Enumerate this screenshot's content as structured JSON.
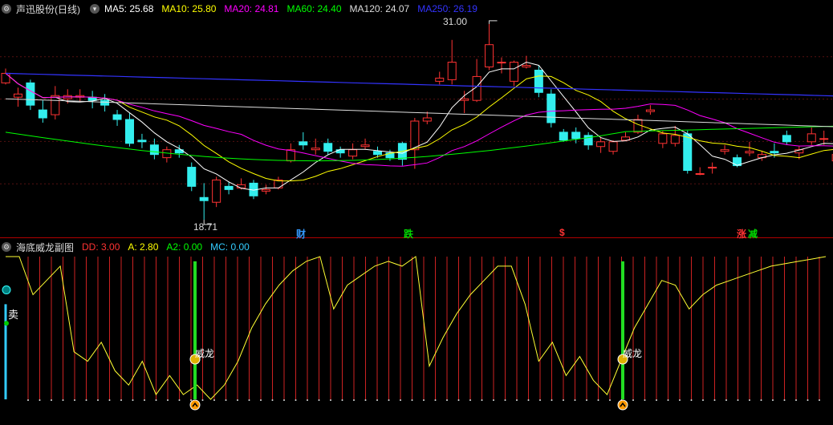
{
  "main": {
    "title": "声迅股份(日线)",
    "ma": [
      {
        "label": "MA5: 25.68",
        "color": "#ffffff"
      },
      {
        "label": "MA10: 25.80",
        "color": "#ffff00"
      },
      {
        "label": "MA20: 24.81",
        "color": "#ff00ff"
      },
      {
        "label": "MA60: 24.40",
        "color": "#00ff00"
      },
      {
        "label": "MA120: 24.07",
        "color": "#dddddd"
      },
      {
        "label": "MA250: 26.19",
        "color": "#3333ff"
      }
    ],
    "high_label": "31.00",
    "low_label": "18.71",
    "events": [
      {
        "text": "财",
        "color": "#3399ff"
      },
      {
        "text": "跌",
        "color": "#00dd00"
      },
      {
        "text": "$",
        "color": "#ff3333"
      },
      {
        "text": "涨",
        "color": "#ff3333"
      },
      {
        "text": "减",
        "color": "#00dd00"
      }
    ]
  },
  "sub": {
    "title": "海底威龙副图",
    "values": [
      {
        "label": "DD: 3.00",
        "color": "#ff3333"
      },
      {
        "label": "A: 2.80",
        "color": "#ffff00"
      },
      {
        "label": "A2: 0.00",
        "color": "#00ff00"
      },
      {
        "label": "MC: 0.00",
        "color": "#33ccff"
      }
    ],
    "sell_label": "卖",
    "signal_label": "威龙",
    "signal_label_2": "威龙"
  },
  "chart_data": {
    "type": "candlestick",
    "price_range": [
      18.71,
      31.0
    ],
    "candles": [
      [
        27.3,
        27.9,
        28.2,
        27.2
      ],
      [
        26.4,
        26.6,
        27.0,
        25.8
      ],
      [
        27.3,
        25.9,
        27.5,
        25.6
      ],
      [
        25.6,
        25.1,
        26.2,
        24.8
      ],
      [
        25.3,
        26.5,
        27.1,
        25.0
      ],
      [
        26.3,
        26.5,
        26.9,
        26.0
      ],
      [
        26.4,
        26.5,
        26.9,
        26.1
      ],
      [
        26.4,
        26.2,
        26.8,
        25.7
      ],
      [
        26.2,
        25.9,
        26.6,
        25.5
      ],
      [
        25.3,
        25.0,
        25.6,
        24.6
      ],
      [
        25.0,
        23.5,
        25.4,
        23.3
      ],
      [
        23.7,
        23.6,
        24.1,
        23.2
      ],
      [
        23.4,
        22.8,
        23.8,
        22.5
      ],
      [
        22.6,
        23.1,
        23.3,
        22.3
      ],
      [
        23.1,
        22.9,
        23.4,
        22.6
      ],
      [
        22.0,
        20.8,
        22.3,
        20.5
      ],
      [
        20.1,
        19.9,
        21.0,
        18.71
      ],
      [
        19.8,
        21.2,
        21.4,
        19.5
      ],
      [
        20.8,
        20.6,
        21.1,
        20.3
      ],
      [
        20.7,
        20.9,
        21.3,
        20.6
      ],
      [
        21.0,
        20.2,
        21.2,
        20.0
      ],
      [
        20.5,
        20.6,
        20.9,
        20.3
      ],
      [
        20.7,
        21.2,
        21.4,
        20.6
      ],
      [
        22.4,
        23.1,
        23.5,
        22.3
      ],
      [
        23.6,
        23.4,
        24.2,
        23.1
      ],
      [
        23.1,
        23.2,
        23.8,
        22.8
      ],
      [
        23.5,
        23.0,
        23.8,
        22.8
      ],
      [
        23.1,
        22.9,
        23.3,
        22.6
      ],
      [
        22.7,
        23.1,
        23.5,
        22.5
      ],
      [
        23.3,
        23.4,
        23.8,
        23.1
      ],
      [
        23.0,
        22.8,
        23.3,
        22.6
      ],
      [
        22.9,
        22.6,
        23.1,
        22.4
      ],
      [
        23.5,
        22.5,
        23.6,
        22.1
      ],
      [
        23.1,
        24.9,
        25.1,
        21.9
      ],
      [
        24.9,
        25.1,
        25.5,
        24.7
      ],
      [
        27.4,
        27.6,
        28.0,
        27.2
      ],
      [
        27.5,
        28.6,
        30.0,
        27.2
      ],
      [
        26.2,
        26.3,
        26.8,
        25.4
      ],
      [
        26.2,
        27.7,
        28.8,
        26.1
      ],
      [
        28.3,
        29.7,
        31.0,
        28.1
      ],
      [
        28.6,
        28.6,
        28.9,
        27.9
      ],
      [
        27.4,
        28.6,
        28.7,
        27.1
      ],
      [
        28.3,
        28.4,
        29.0,
        28.2
      ],
      [
        28.1,
        26.7,
        28.4,
        26.4
      ],
      [
        26.6,
        24.8,
        26.9,
        24.5
      ],
      [
        24.2,
        23.7,
        24.4,
        23.6
      ],
      [
        24.2,
        23.8,
        24.5,
        23.5
      ],
      [
        24.0,
        23.4,
        24.2,
        23.1
      ],
      [
        23.3,
        23.6,
        23.9,
        22.9
      ],
      [
        23.0,
        23.6,
        23.7,
        22.8
      ],
      [
        23.7,
        23.9,
        24.2,
        23.7
      ],
      [
        24.2,
        25.0,
        25.3,
        24.1
      ],
      [
        25.5,
        25.6,
        25.9,
        25.3
      ],
      [
        23.5,
        24.1,
        24.3,
        23.2
      ],
      [
        23.5,
        24.0,
        24.6,
        23.3
      ],
      [
        24.1,
        21.8,
        24.3,
        21.6
      ],
      [
        21.6,
        21.6,
        22.0,
        21.5
      ],
      [
        22.0,
        22.0,
        22.3,
        21.6
      ],
      [
        23.0,
        23.1,
        23.4,
        22.8
      ],
      [
        22.6,
        22.1,
        22.8,
        22.0
      ],
      [
        22.9,
        23.0,
        23.6,
        22.7
      ],
      [
        22.6,
        22.8,
        23.0,
        22.4
      ],
      [
        23.0,
        22.9,
        23.5,
        22.6
      ],
      [
        24.0,
        23.6,
        24.3,
        23.4
      ],
      [
        22.9,
        23.1,
        23.3,
        22.5
      ],
      [
        23.6,
        24.1,
        24.5,
        23.4
      ],
      [
        23.8,
        23.8,
        24.3,
        23.4
      ],
      [
        22.4,
        22.8,
        23.7,
        22.3
      ],
      [
        23.1,
        23.6,
        23.8,
        22.8
      ],
      [
        23.6,
        23.5,
        24.0,
        22.9
      ],
      [
        23.7,
        23.6,
        24.1,
        23.2
      ],
      [
        24.3,
        24.6,
        26.7,
        24.3
      ],
      [
        26.4,
        24.8,
        27.2,
        24.5
      ],
      [
        24.8,
        25.3,
        26.0,
        24.6
      ],
      [
        25.7,
        25.5,
        26.2,
        25.0
      ],
      [
        26.1,
        25.4,
        26.4,
        25.0
      ],
      [
        25.9,
        25.9,
        26.3,
        25.3
      ],
      [
        24.9,
        25.4,
        25.5,
        24.6
      ],
      [
        25.6,
        25.3,
        25.9,
        25.0
      ],
      [
        25.2,
        25.7,
        26.1,
        24.9
      ],
      [
        25.9,
        25.4,
        26.3,
        25.0
      ]
    ],
    "ma_lines": {
      "MA5": "#ffffff",
      "MA10": "#ffff00",
      "MA20": "#ff00ff",
      "MA60": "#00ff00",
      "MA120": "#dddddd",
      "MA250": "#3333ff"
    },
    "sub_series": {
      "A_line": [
        [
          3.0,
          3.0,
          2.2,
          2.5,
          2.8,
          1.0,
          0.8,
          1.2,
          0.6,
          0.3,
          0.8,
          0.1,
          0.5,
          0.1,
          0.3,
          0.0,
          0.3,
          0.8,
          1.5,
          2.0,
          2.4,
          2.7,
          2.9,
          3.0,
          1.9,
          2.4,
          2.6,
          2.8,
          2.9,
          2.8,
          3.0,
          0.7,
          1.3,
          1.8,
          2.2,
          2.5,
          2.8,
          2.8,
          2.0,
          0.8,
          1.2,
          0.5,
          0.9,
          0.4,
          0.1,
          0.8,
          1.5,
          2.0,
          2.5,
          2.4,
          1.9,
          2.2,
          2.4,
          2.5,
          2.6,
          2.7,
          2.8,
          2.85,
          2.9,
          2.95,
          3.0
        ]
      ],
      "signals": [
        "卖",
        "威龙",
        "威龙"
      ]
    }
  }
}
